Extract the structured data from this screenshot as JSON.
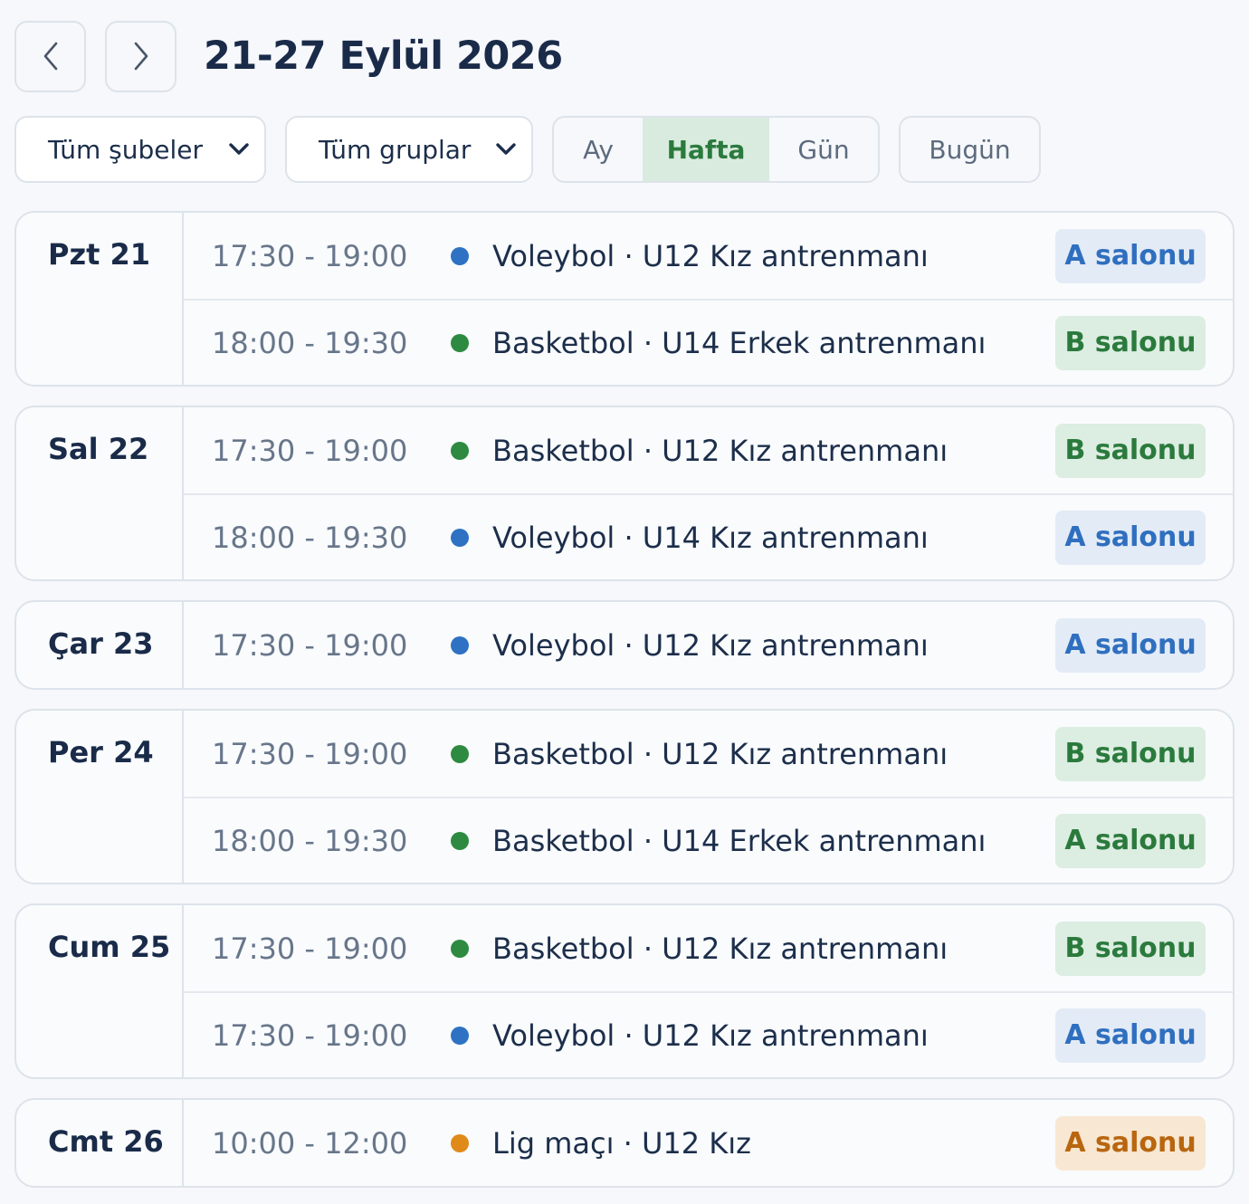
{
  "header": {
    "title": "21-27 Eylül 2026",
    "prev_icon": "chevron-left-icon",
    "next_icon": "chevron-right-icon"
  },
  "filters": {
    "branch_select": "Tüm şubeler",
    "group_select": "Tüm gruplar",
    "view_tabs": [
      "Ay",
      "Hafta",
      "Gün"
    ],
    "active_view": "Hafta",
    "today_label": "Bugün"
  },
  "colors": {
    "voleybol": "#2f72c4",
    "basketbol": "#2d8a40",
    "lig": "#e08a1a",
    "badge_blue_bg": "#e3ebf6",
    "badge_blue_text": "#2f6fbf",
    "badge_green_bg": "#dcede1",
    "badge_green_text": "#2b7a3d",
    "badge_orange_bg": "#f8e7d2",
    "badge_orange_text": "#b8660f"
  },
  "days": [
    {
      "label": "Pzt 21",
      "events": [
        {
          "time": "17:30 - 19:00",
          "title": "Voleybol · U12 Kız antrenmanı",
          "hall": "A salonu",
          "kind": "voleybol",
          "badge": "blue"
        },
        {
          "time": "18:00 - 19:30",
          "title": "Basketbol · U14 Erkek antrenmanı",
          "hall": "B salonu",
          "kind": "basketbol",
          "badge": "green"
        }
      ]
    },
    {
      "label": "Sal 22",
      "events": [
        {
          "time": "17:30 - 19:00",
          "title": "Basketbol · U12 Kız antrenmanı",
          "hall": "B salonu",
          "kind": "basketbol",
          "badge": "green"
        },
        {
          "time": "18:00 - 19:30",
          "title": "Voleybol · U14 Kız antrenmanı",
          "hall": "A salonu",
          "kind": "voleybol",
          "badge": "blue"
        }
      ]
    },
    {
      "label": "Çar 23",
      "events": [
        {
          "time": "17:30 - 19:00",
          "title": "Voleybol · U12 Kız antrenmanı",
          "hall": "A salonu",
          "kind": "voleybol",
          "badge": "blue"
        }
      ]
    },
    {
      "label": "Per 24",
      "events": [
        {
          "time": "17:30 - 19:00",
          "title": "Basketbol · U12 Kız antrenmanı",
          "hall": "B salonu",
          "kind": "basketbol",
          "badge": "green"
        },
        {
          "time": "18:00 - 19:30",
          "title": "Basketbol · U14 Erkek antrenmanı",
          "hall": "A salonu",
          "kind": "basketbol",
          "badge": "green"
        }
      ]
    },
    {
      "label": "Cum 25",
      "events": [
        {
          "time": "17:30 - 19:00",
          "title": "Basketbol · U12 Kız antrenmanı",
          "hall": "B salonu",
          "kind": "basketbol",
          "badge": "green"
        },
        {
          "time": "17:30 - 19:00",
          "title": "Voleybol · U12 Kız antrenmanı",
          "hall": "A salonu",
          "kind": "voleybol",
          "badge": "blue"
        }
      ]
    },
    {
      "label": "Cmt 26",
      "events": [
        {
          "time": "10:00 - 12:00",
          "title": "Lig maçı · U12 Kız",
          "hall": "A salonu",
          "kind": "lig",
          "badge": "orange"
        }
      ]
    }
  ]
}
